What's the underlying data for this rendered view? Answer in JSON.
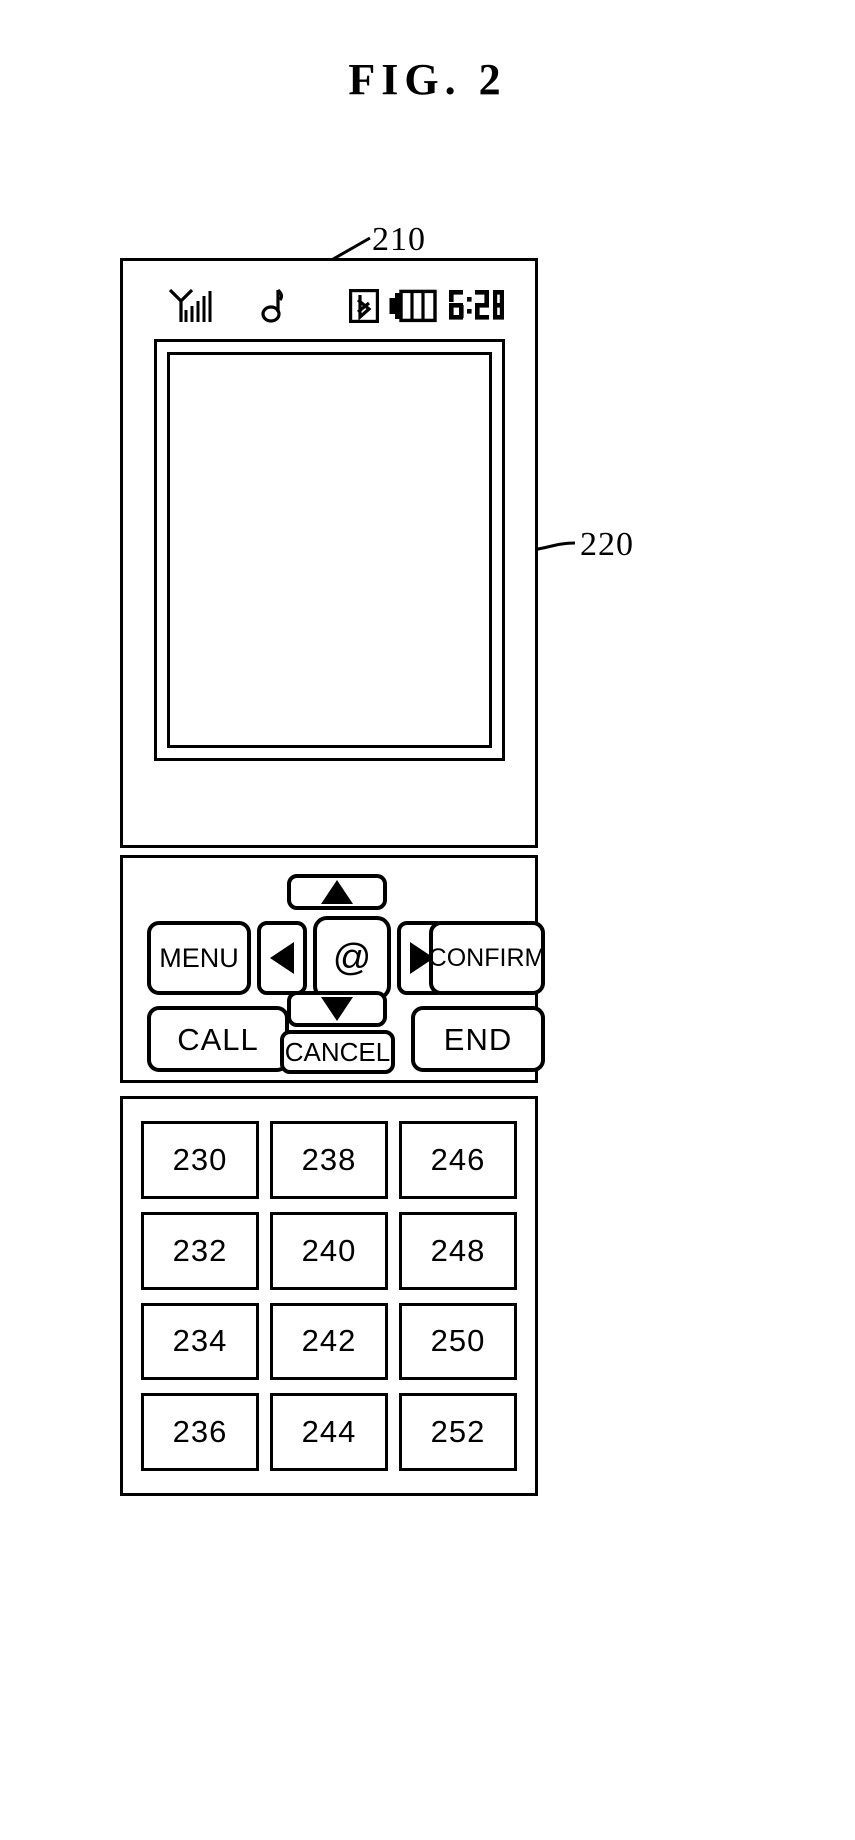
{
  "figure": {
    "title": "FIG. 2"
  },
  "callouts": [
    {
      "id": "210",
      "label": "210",
      "target": "phone-upper-body"
    },
    {
      "id": "220",
      "label": "220",
      "target": "display-screen"
    }
  ],
  "device": {
    "status_bar": {
      "icons": [
        {
          "name": "signal-strength-icon",
          "label": "signal"
        },
        {
          "name": "music-note-icon",
          "label": "music"
        },
        {
          "name": "bluetooth-icon",
          "label": "bluetooth"
        },
        {
          "name": "battery-icon",
          "label": "battery"
        }
      ],
      "clock": "6:28"
    },
    "display": {
      "name": "display-screen",
      "content": ""
    },
    "navigation_keys": {
      "up": {
        "label": "",
        "icon": "arrow-up-icon"
      },
      "menu": {
        "label": "MENU"
      },
      "left": {
        "label": "",
        "icon": "arrow-left-icon"
      },
      "center": {
        "label": "@"
      },
      "right": {
        "label": "",
        "icon": "arrow-right-icon"
      },
      "confirm": {
        "label": "CONFIRM"
      },
      "call": {
        "label": "CALL"
      },
      "down": {
        "label": "",
        "icon": "arrow-down-icon"
      },
      "cancel": {
        "label": "CANCEL"
      },
      "end": {
        "label": "END"
      }
    },
    "keypad": {
      "columns": 3,
      "rows": 4,
      "keys": [
        "230",
        "238",
        "246",
        "232",
        "240",
        "248",
        "234",
        "242",
        "250",
        "236",
        "244",
        "252"
      ]
    }
  },
  "colors": {
    "ink": "#000000",
    "paper": "#ffffff"
  }
}
